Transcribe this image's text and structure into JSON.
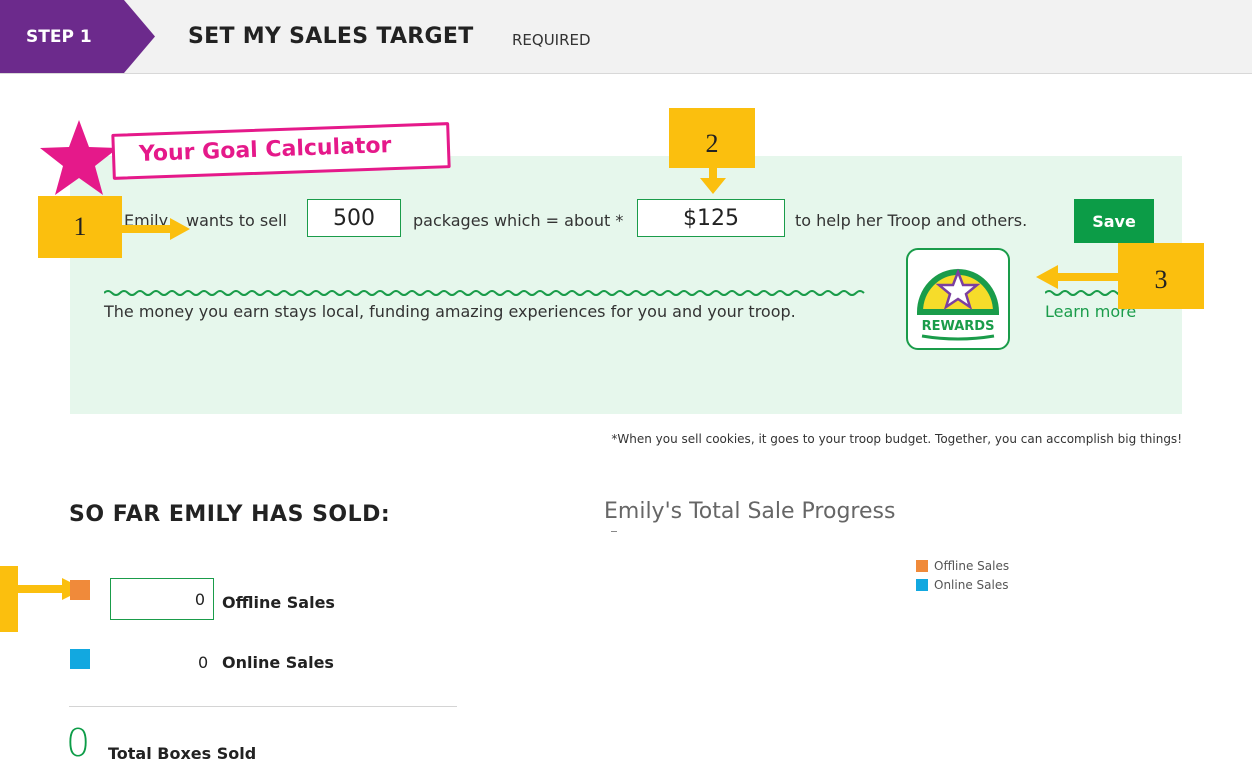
{
  "header": {
    "step": "STEP 1",
    "title": "SET MY SALES TARGET",
    "required": "REQUIRED"
  },
  "colors": {
    "brand_purple": "#6c2a8c",
    "accent_green": "#0c9c47",
    "panel_bg": "#e6f7ec",
    "pink": "#e5198a",
    "offline": "#f08a3a",
    "online": "#12a8e0",
    "callout": "#fbbf0e"
  },
  "calculator": {
    "title": "Your Goal Calculator",
    "name": "Emily",
    "wants_to_sell": "wants to sell",
    "packages_value": "500",
    "which_about": "packages which = about *",
    "dollar_value": "$125",
    "help_text": "to help her Troop and others.",
    "save_label": "Save",
    "money_text": "The money you earn stays local, funding amazing experiences for you and your troop.",
    "rewards_label": "REWARDS",
    "learn_more": "Learn more",
    "footnote": "*When you sell cookies, it goes to your troop budget. Together, you can accomplish big things!"
  },
  "callouts": [
    "1",
    "2",
    "3"
  ],
  "sold": {
    "heading": "SO FAR EMILY HAS SOLD:",
    "offline_value": "0",
    "offline_label": "Offline Sales",
    "online_value": "0",
    "online_label": "Online Sales",
    "total_value": "0",
    "total_label": "Total Boxes Sold"
  },
  "chart": {
    "title": "Emily's Total Sale Progress",
    "legend": [
      "Offline Sales",
      "Online Sales"
    ]
  },
  "chart_data": {
    "type": "pie",
    "title": "Emily's Total Sale Progress",
    "categories": [
      "Offline Sales",
      "Online Sales"
    ],
    "values": [
      0,
      0
    ],
    "legend_placement": "right"
  }
}
